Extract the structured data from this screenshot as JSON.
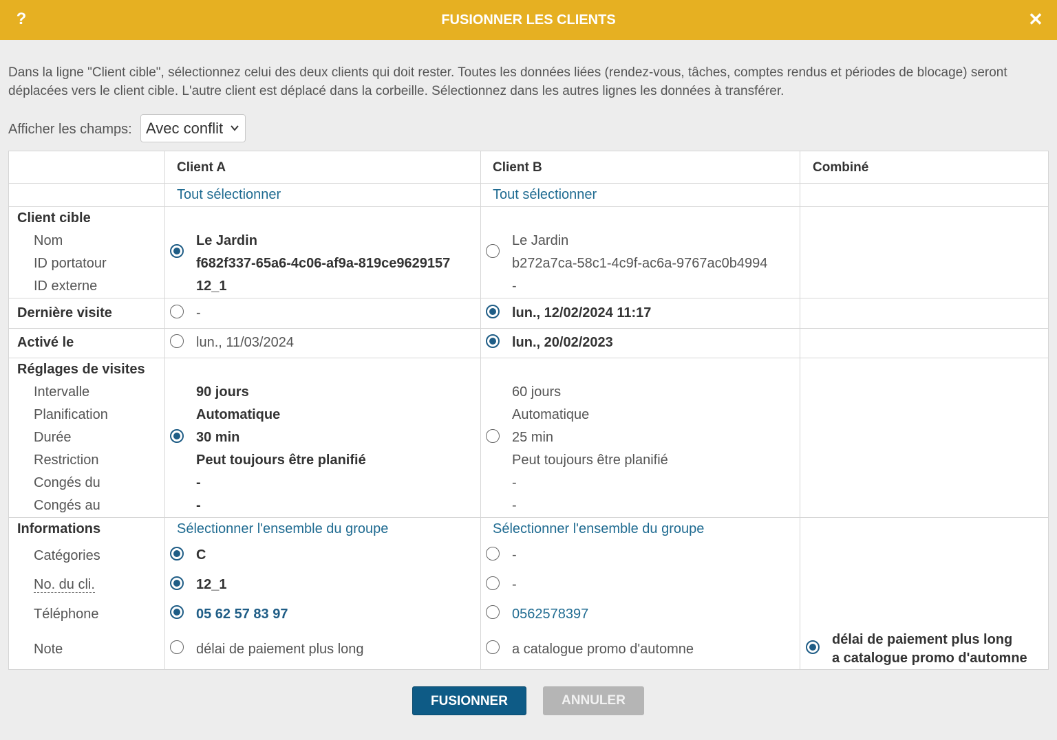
{
  "dialog": {
    "title": "FUSIONNER LES CLIENTS",
    "help_label": "?",
    "close_label": "✕",
    "intro": "Dans la ligne \"Client cible\", sélectionnez celui des deux clients qui doit rester. Toutes les données liées (rendez-vous, tâches, comptes rendus et périodes de blocage) seront déplacées vers le client cible. L'autre client est déplacé dans la corbeille. Sélectionnez dans les autres lignes les données à transférer.",
    "filter_label": "Afficher les champs:",
    "filter_value": "Avec conflit"
  },
  "columns": {
    "client_a": "Client A",
    "client_b": "Client B",
    "combined": "Combiné",
    "select_all": "Tout sélectionner",
    "select_group": "Sélectionner l'ensemble du groupe"
  },
  "sections": {
    "target": {
      "title": "Client cible",
      "labels": [
        "Nom",
        "ID portatour",
        "ID externe"
      ],
      "a": [
        "Le Jardin",
        "f682f337-65a6-4c06-af9a-819ce9629157",
        "12_1"
      ],
      "b": [
        "Le Jardin",
        "b272a7ca-58c1-4c9f-ac6a-9767ac0b4994",
        "-"
      ],
      "selected": "a"
    },
    "last_visit": {
      "title": "Dernière visite",
      "a": "-",
      "b": "lun., 12/02/2024 11:17",
      "selected": "b"
    },
    "activated": {
      "title": "Activé le",
      "a": "lun., 11/03/2024",
      "b": "lun., 20/02/2023",
      "selected": "b"
    },
    "visit_settings": {
      "title": "Réglages de visites",
      "labels": [
        "Intervalle",
        "Planification",
        "Durée",
        "Restriction",
        "Congés du",
        "Congés au"
      ],
      "a": [
        "90 jours",
        "Automatique",
        "30 min",
        "Peut toujours être planifié",
        "-",
        "-"
      ],
      "b": [
        "60 jours",
        "Automatique",
        "25 min",
        "Peut toujours être planifié",
        "-",
        "-"
      ],
      "selected": "a"
    },
    "info": {
      "title": "Informations",
      "labels": [
        "Catégories",
        "No. du cli.",
        "Téléphone",
        "Note"
      ],
      "a": [
        "C",
        "12_1",
        "05 62 57 83 97",
        "délai de paiement plus long"
      ],
      "b": [
        "-",
        "-",
        "0562578397",
        "a catalogue promo d'automne"
      ],
      "combined_note": [
        "délai de paiement plus long",
        "a catalogue promo d'automne"
      ]
    }
  },
  "buttons": {
    "merge": "FUSIONNER",
    "cancel": "ANNULER"
  },
  "colors": {
    "titlebar": "#e6b022",
    "primary": "#0e5b86",
    "link": "#1f6b91",
    "disabled": "#b5b5b5"
  }
}
